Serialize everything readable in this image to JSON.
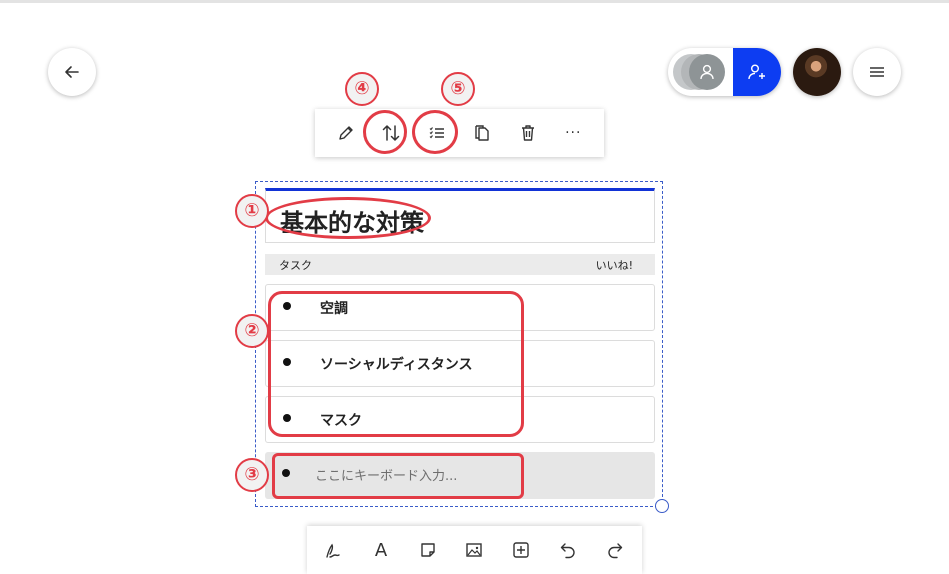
{
  "colors": {
    "accent": "#1233d6",
    "annotation": "#e23c46",
    "collab_add": "#0d3df2"
  },
  "nav": {
    "back_icon": "arrow-left-icon",
    "menu_icon": "hamburger-icon"
  },
  "toolbar": {
    "items": [
      {
        "icon": "pencil-icon"
      },
      {
        "icon": "sort-arrows-icon"
      },
      {
        "icon": "checklist-icon"
      },
      {
        "icon": "copy-icon"
      },
      {
        "icon": "trash-icon"
      },
      {
        "icon": "more-icon",
        "label": "···"
      }
    ]
  },
  "card": {
    "title": "基本的な対策",
    "col_task": "タスク",
    "col_like": "いいね!",
    "tasks": [
      "空調",
      "ソーシャルディスタンス",
      "マスク"
    ],
    "input_placeholder": "ここにキーボード入力..."
  },
  "bottom_toolbar": {
    "items": [
      "pen-icon",
      "text-icon",
      "sticky-note-icon",
      "image-icon",
      "add-box-icon",
      "undo-icon",
      "redo-icon"
    ],
    "text_label": "A"
  },
  "annotations": [
    "①",
    "②",
    "③",
    "④",
    "⑤"
  ]
}
